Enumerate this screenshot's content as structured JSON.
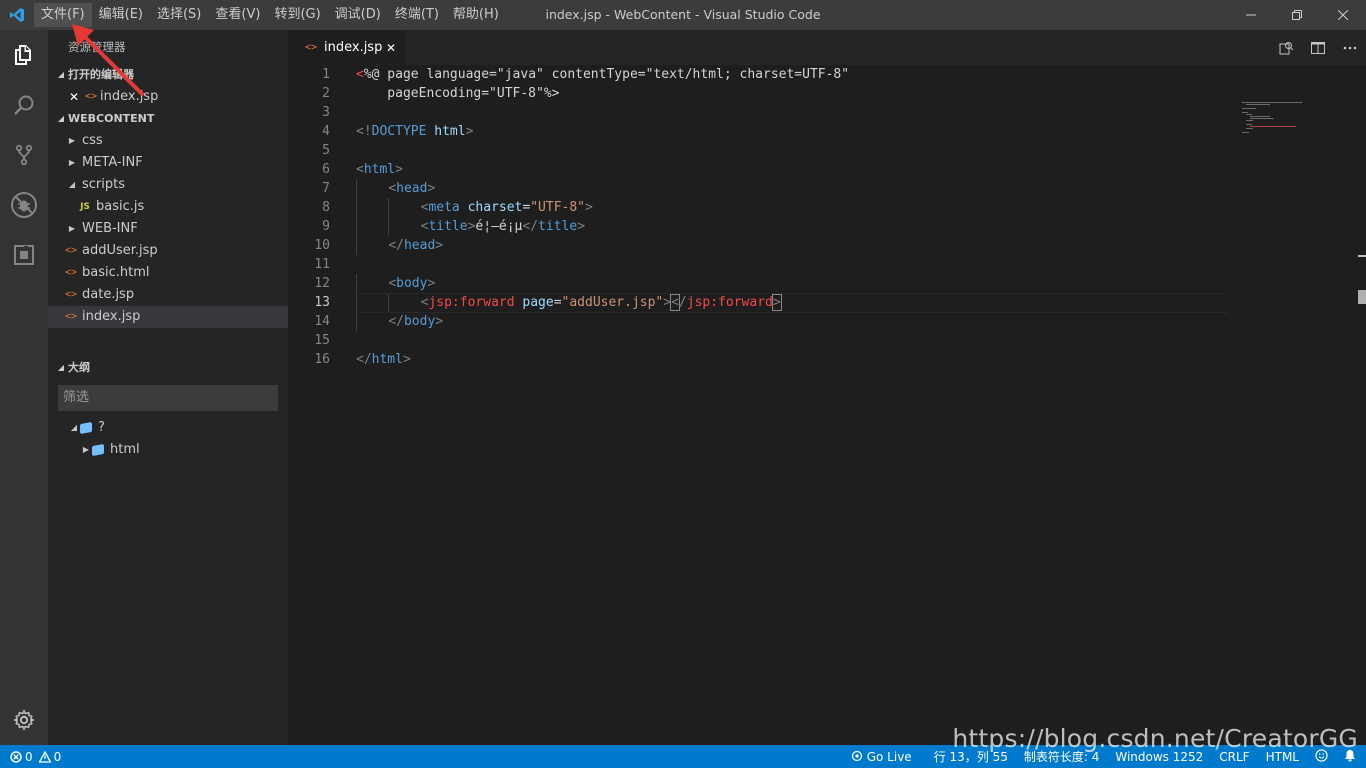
{
  "window": {
    "title": "index.jsp - WebContent - Visual Studio Code",
    "minimize": "—",
    "maximize": "❐",
    "close": "✕"
  },
  "menu": [
    "文件(F)",
    "编辑(E)",
    "选择(S)",
    "查看(V)",
    "转到(G)",
    "调试(D)",
    "终端(T)",
    "帮助(H)"
  ],
  "sidebar": {
    "title": "资源管理器",
    "open_editors": {
      "header": "打开的编辑器",
      "items": [
        {
          "label": "index.jsp"
        }
      ]
    },
    "workspace": {
      "header": "WEBCONTENT",
      "items": [
        {
          "label": "css",
          "type": "folder",
          "expanded": false
        },
        {
          "label": "META-INF",
          "type": "folder",
          "expanded": false
        },
        {
          "label": "scripts",
          "type": "folder",
          "expanded": true
        },
        {
          "label": "basic.js",
          "type": "js",
          "icon": "JS"
        },
        {
          "label": "WEB-INF",
          "type": "folder",
          "expanded": false
        },
        {
          "label": "addUser.jsp",
          "type": "html"
        },
        {
          "label": "basic.html",
          "type": "html"
        },
        {
          "label": "date.jsp",
          "type": "html"
        },
        {
          "label": "index.jsp",
          "type": "html",
          "selected": true
        }
      ]
    },
    "outline": {
      "header": "大纲",
      "filter_placeholder": "筛选",
      "items": [
        {
          "label": "?"
        },
        {
          "label": "html"
        }
      ]
    }
  },
  "editor": {
    "tab": {
      "label": "index.jsp",
      "close": "✕"
    },
    "current_line": 13,
    "lines": [
      {
        "n": "1"
      },
      {
        "n": "2"
      },
      {
        "n": "3"
      },
      {
        "n": "4"
      },
      {
        "n": "5"
      },
      {
        "n": "6"
      },
      {
        "n": "7"
      },
      {
        "n": "8"
      },
      {
        "n": "9"
      },
      {
        "n": "10"
      },
      {
        "n": "11"
      },
      {
        "n": "12"
      },
      {
        "n": "13"
      },
      {
        "n": "14"
      },
      {
        "n": "15"
      },
      {
        "n": "16"
      }
    ],
    "code": {
      "l1_open": "<",
      "l1_jsp": "%@",
      "l1_rest": " page language=\"java\" contentType=\"text/html; charset=UTF-8\"",
      "l2": "    pageEncoding=\"UTF-8\"%>",
      "l4_open": "<!",
      "l4_doctype": "DOCTYPE",
      "l4_html": " html",
      "l4_close": ">",
      "tag_html": "html",
      "tag_head": "head",
      "tag_meta": "meta",
      "attr_charset": "charset",
      "val_utf8": "\"UTF-8\"",
      "tag_title": "title",
      "title_text": "é¦–é¡µ",
      "tag_body": "body",
      "tag_jsp_forward": "jsp:forward",
      "attr_page": "page",
      "val_page": "\"addUser.jsp\""
    }
  },
  "statusbar": {
    "errors": "0",
    "warnings": "0",
    "go_live": "Go Live",
    "position": "行 13，列 55",
    "tab_size": "制表符长度: 4",
    "encoding": "Windows 1252",
    "eol": "CRLF",
    "language": "HTML"
  },
  "watermark": "https://blog.csdn.net/CreatorGG",
  "colors": {
    "accent": "#007acc",
    "annotation_arrow": "#e53935"
  }
}
